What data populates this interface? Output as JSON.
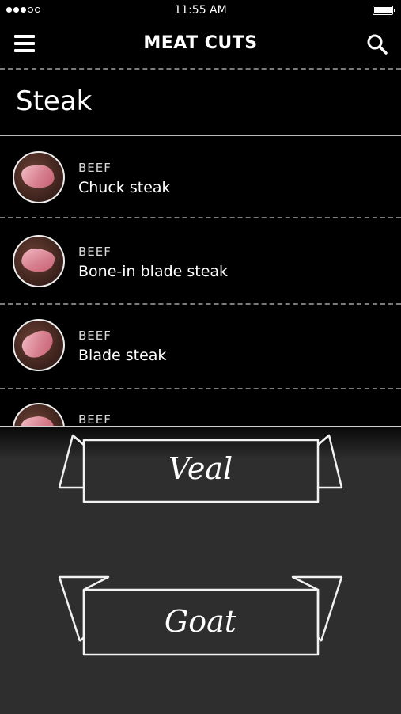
{
  "status_bar": {
    "time": "11:55 AM",
    "signal_dots_filled": 3,
    "signal_dots_total": 5,
    "battery_level": 1.0
  },
  "nav": {
    "menu_icon": "hamburger-menu-icon",
    "title": "MEAT CUTS",
    "search_icon": "search-icon"
  },
  "section": {
    "title": "Steak"
  },
  "items": [
    {
      "category": "BEEF",
      "name": "Chuck steak"
    },
    {
      "category": "BEEF",
      "name": "Bone-in blade steak"
    },
    {
      "category": "BEEF",
      "name": "Blade steak"
    },
    {
      "category": "BEEF",
      "name": ""
    }
  ],
  "banners": [
    {
      "label": "Veal"
    },
    {
      "label": "Goat"
    }
  ],
  "colors": {
    "background": "#000000",
    "chalkboard": "#2e2e2e",
    "text": "#ffffff",
    "subtext": "#d8d8d8"
  }
}
